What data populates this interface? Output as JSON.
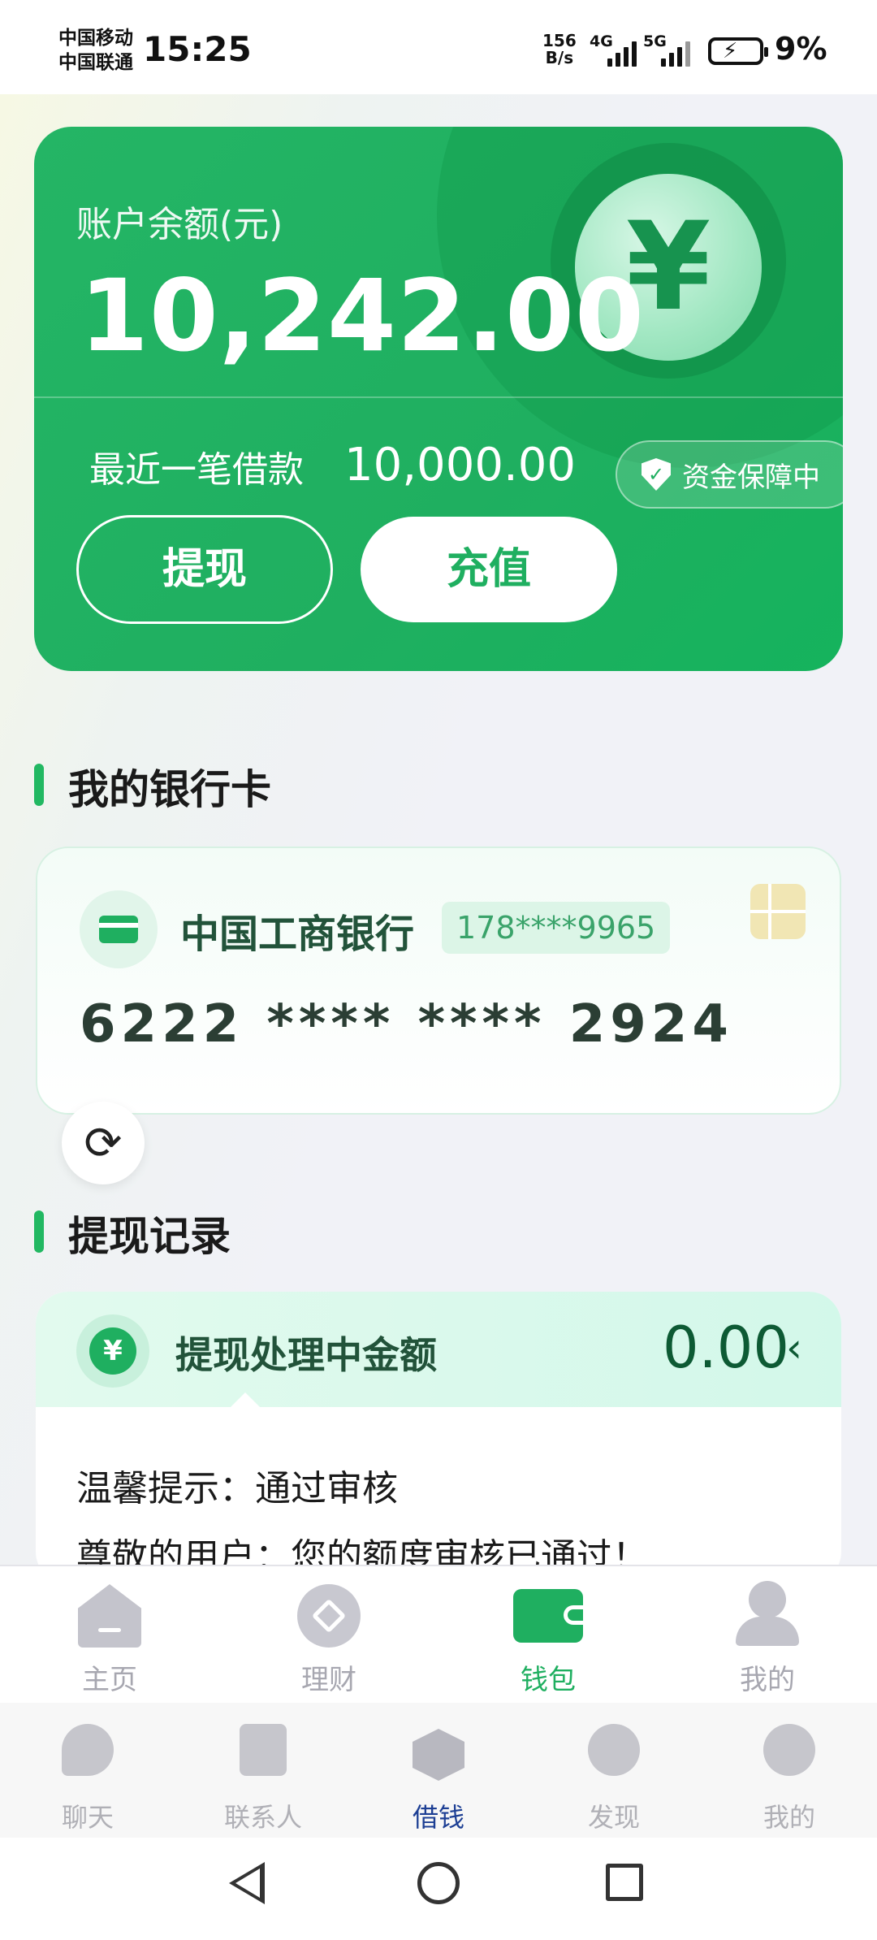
{
  "status_bar": {
    "carrier1": "中国移动",
    "carrier2": "中国联通",
    "time": "15:25",
    "net_speed_value": "156",
    "net_speed_unit": "B/s",
    "sim1_label": "4G",
    "sim2_label": "5G",
    "battery": "9%"
  },
  "balance_card": {
    "label": "账户余额(元)",
    "amount": "10,242.00",
    "coin_symbol": "¥",
    "recent_loan_label": "最近一笔借款",
    "recent_loan_amount": "10,000.00",
    "protect_badge": "资金保障中",
    "withdraw_button": "提现",
    "recharge_button": "充值"
  },
  "bank_section": {
    "title": "我的银行卡",
    "bank_name": "中国工商银行",
    "phone": "178****9965",
    "card_number": "6222 **** **** 2924"
  },
  "record_section": {
    "title": "提现记录",
    "pending_label": "提现处理中金额",
    "pending_amount": "0.00",
    "tip_line1": "温馨提示：通过审核",
    "tip_line2": "尊敬的用户：您的额度审核已通过！"
  },
  "app_tabs": [
    {
      "label": "主页"
    },
    {
      "label": "理财"
    },
    {
      "label": "钱包",
      "active": true
    },
    {
      "label": "我的"
    }
  ],
  "wechat_tabs": [
    {
      "label": "聊天"
    },
    {
      "label": "联系人"
    },
    {
      "label": "借钱",
      "active": true
    },
    {
      "label": "发现"
    },
    {
      "label": "我的"
    }
  ],
  "colors": {
    "brand_green": "#1faf60",
    "active_wechat_tab": "#1d3f94"
  }
}
